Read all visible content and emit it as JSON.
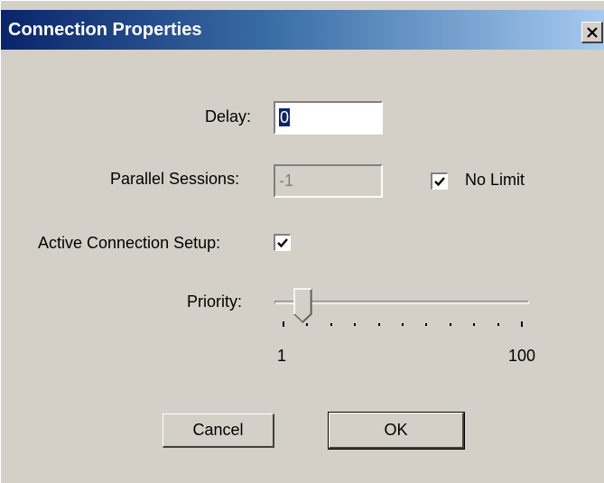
{
  "window": {
    "title": "Connection Properties"
  },
  "fields": {
    "delay_label": "Delay:",
    "delay_value": "0",
    "parallel_label": "Parallel Sessions:",
    "parallel_value": "-1",
    "no_limit_label": "No Limit",
    "no_limit_checked": true,
    "active_label": "Active Connection Setup:",
    "active_checked": true
  },
  "priority": {
    "label": "Priority:",
    "min_label": "1",
    "max_label": "100",
    "min": 1,
    "max": 100,
    "value": 8
  },
  "buttons": {
    "cancel": "Cancel",
    "ok": "OK"
  },
  "colors": {
    "titlebar_start": "#0a246a",
    "titlebar_end": "#a6caf0",
    "face": "#d4d0c8"
  },
  "icons": {
    "close": "close-x-icon",
    "check": "checkmark-icon"
  }
}
